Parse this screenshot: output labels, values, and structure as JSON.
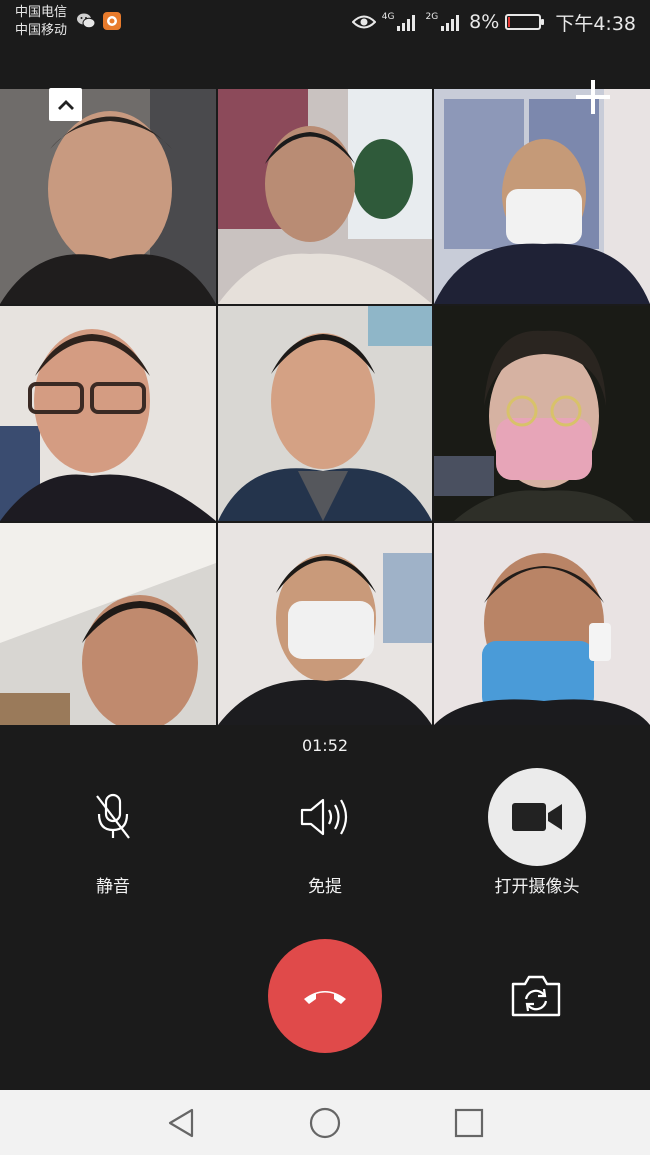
{
  "status_bar": {
    "carrier_1": "中国电信",
    "carrier_2": "中国移动",
    "notification_icons": [
      "wechat-icon",
      "app-notification-icon"
    ],
    "network_1": "4G",
    "network_2": "2G",
    "battery": "8%",
    "battery_level": 0.08,
    "time": "下午4:38"
  },
  "call": {
    "duration": "01:52",
    "participant_count": 9
  },
  "controls": {
    "mute_label": "静音",
    "speaker_label": "免提",
    "camera_label": "打开摄像头"
  },
  "colors": {
    "background": "#1b1b1b",
    "hangup": "#e04a4a",
    "camera_button": "#ebebeb",
    "nav_bar": "#f2f2f2"
  }
}
